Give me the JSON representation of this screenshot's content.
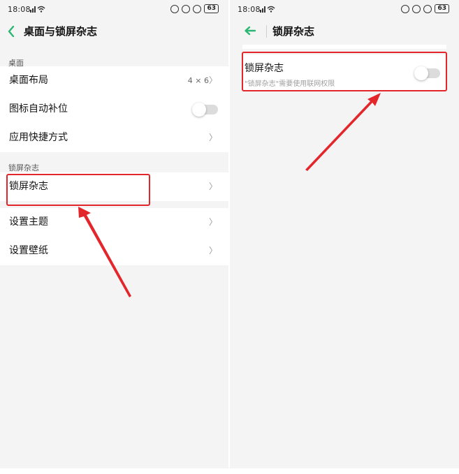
{
  "left": {
    "status": {
      "time": "18:08",
      "battery": "63"
    },
    "nav": {
      "title": "桌面与锁屏杂志",
      "back_icon": "chevron-left-icon"
    },
    "section_desktop": {
      "header": "桌面"
    },
    "desktop_items": [
      {
        "label": "桌面布局",
        "value": "4 × 6"
      },
      {
        "label": "图标自动补位",
        "toggle_on": false
      },
      {
        "label": "应用快捷方式"
      }
    ],
    "section_lock": {
      "header": "锁屏杂志"
    },
    "lock_items": [
      {
        "label": "锁屏杂志"
      }
    ],
    "theme_items": [
      {
        "label": "设置主题"
      },
      {
        "label": "设置壁纸"
      }
    ]
  },
  "right": {
    "status": {
      "time": "18:08",
      "battery": "63"
    },
    "nav": {
      "title": "锁屏杂志",
      "back_icon": "arrow-left-icon"
    },
    "setting": {
      "label": "锁屏杂志",
      "description": "\"锁屏杂志\"需要使用联网权限",
      "toggle_on": false
    }
  },
  "colors": {
    "accent": "#2bb673",
    "highlight": "#e3262b",
    "background": "#f4f4f4"
  }
}
